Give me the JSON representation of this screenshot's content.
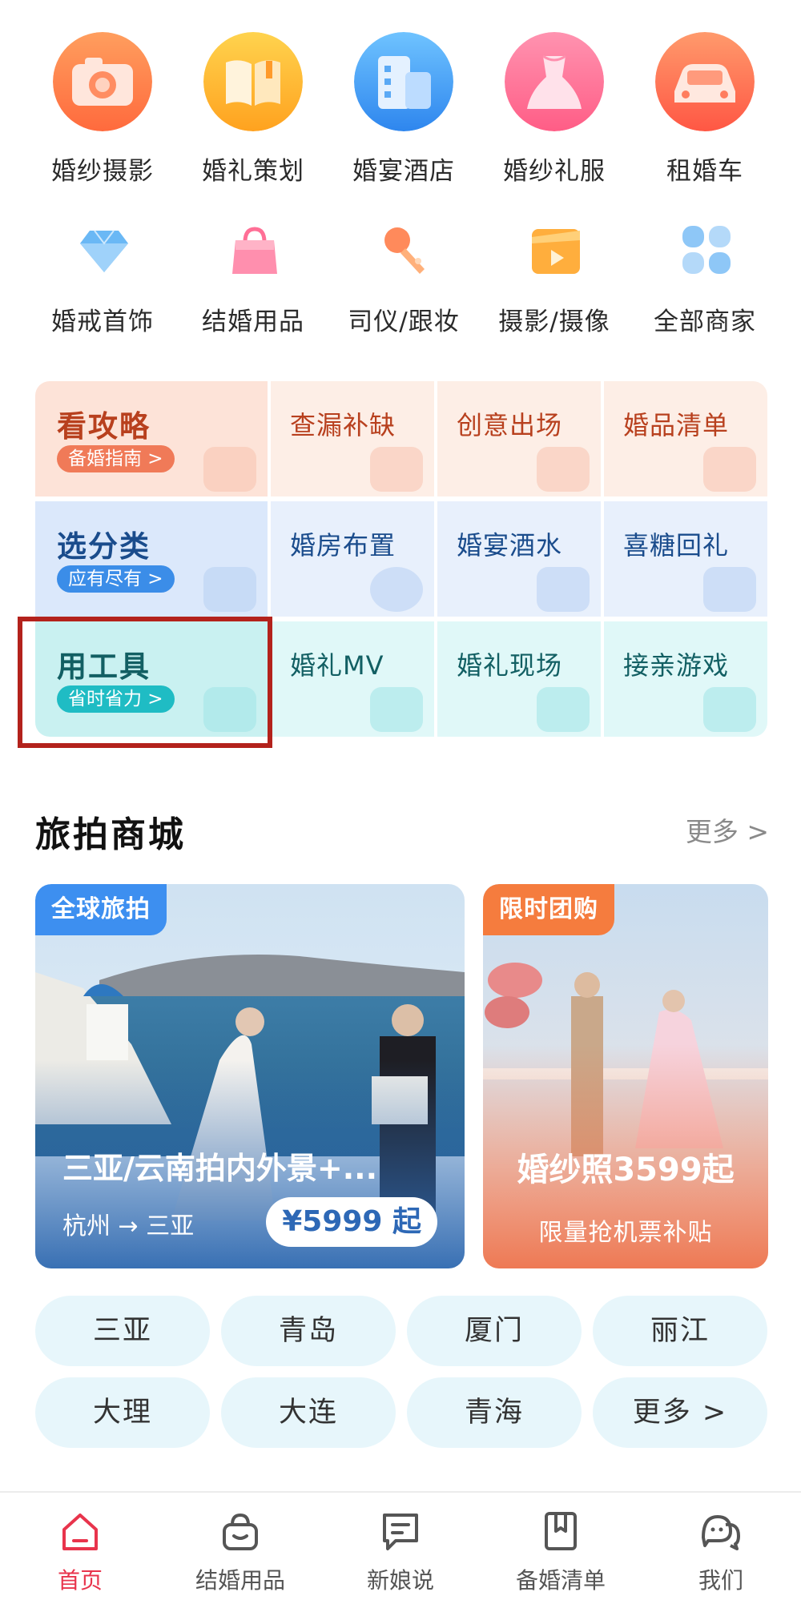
{
  "categories_primary": [
    {
      "label": "婚纱摄影",
      "icon": "camera-icon",
      "color": "#ff7a45"
    },
    {
      "label": "婚礼策划",
      "icon": "book-icon",
      "color": "#ffb02e"
    },
    {
      "label": "婚宴酒店",
      "icon": "building-icon",
      "color": "#3f9cf5"
    },
    {
      "label": "婚纱礼服",
      "icon": "dress-icon",
      "color": "#ff6f93"
    },
    {
      "label": "租婚车",
      "icon": "car-icon",
      "color": "#ff6b55"
    }
  ],
  "categories_secondary": [
    {
      "label": "婚戒首饰",
      "icon": "diamond-icon",
      "color": "#5bb4f5"
    },
    {
      "label": "结婚用品",
      "icon": "bag-icon",
      "color": "#ff7fa2"
    },
    {
      "label": "司仪/跟妆",
      "icon": "microphone-icon",
      "color": "#ff8a5b"
    },
    {
      "label": "摄影/摄像",
      "icon": "video-icon",
      "color": "#ffae3d"
    },
    {
      "label": "全部商家",
      "icon": "grid-icon",
      "color": "#7cb8f2"
    }
  ],
  "guide": {
    "rows": [
      {
        "title": "看攻略",
        "pill": "备婚指南 >",
        "items": [
          "查漏补缺",
          "创意出场",
          "婚品清单"
        ],
        "title_color": "#b8401e",
        "pill_color": "#f07a58",
        "head_bg": "#fde3d8",
        "cell_bg": "#fdeee6",
        "deco_color": "#f7c3af"
      },
      {
        "title": "选分类",
        "pill": "应有尽有 >",
        "items": [
          "婚房布置",
          "婚宴酒水",
          "喜糖回礼"
        ],
        "title_color": "#1a4c8c",
        "pill_color": "#3b8de8",
        "head_bg": "#dbe8fb",
        "cell_bg": "#e8f0fc",
        "deco_color": "#b6d0f3"
      },
      {
        "title": "用工具",
        "pill": "省时省力 >",
        "items": [
          "婚礼MV",
          "婚礼现场",
          "接亲游戏"
        ],
        "title_color": "#125f63",
        "pill_color": "#1fbcc4",
        "head_bg": "#c9f1f1",
        "cell_bg": "#e0f8f8",
        "deco_color": "#9fe3e5"
      }
    ]
  },
  "section": {
    "title": "旅拍商城",
    "more": "更多 >"
  },
  "cards": [
    {
      "tag": "全球旅拍",
      "title": "三亚/云南拍内外景+...",
      "route": "杭州 → 三亚",
      "price": "¥5999 起",
      "tag_color": "#3d8ff0"
    },
    {
      "tag": "限时团购",
      "title": "婚纱照3599起",
      "subtitle": "限量抢机票补贴",
      "tag_color": "#f57c3e"
    }
  ],
  "cities": [
    "三亚",
    "青岛",
    "厦门",
    "丽江",
    "大理",
    "大连",
    "青海",
    "更多 >"
  ],
  "nav": [
    {
      "label": "首页",
      "icon": "home-icon",
      "active": true
    },
    {
      "label": "结婚用品",
      "icon": "shopping-bag-icon",
      "active": false
    },
    {
      "label": "新娘说",
      "icon": "message-icon",
      "active": false
    },
    {
      "label": "备婚清单",
      "icon": "notebook-icon",
      "active": false
    },
    {
      "label": "我们",
      "icon": "couple-icon",
      "active": false
    }
  ]
}
